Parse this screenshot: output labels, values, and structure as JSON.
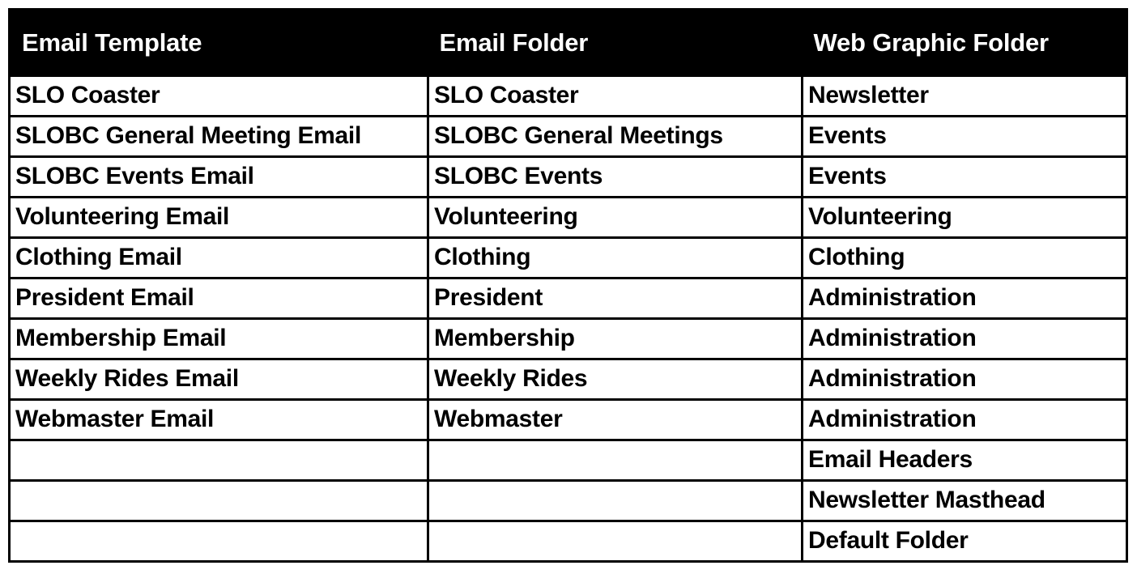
{
  "table": {
    "columns": [
      {
        "key": "email_template",
        "label": "Email Template"
      },
      {
        "key": "email_folder",
        "label": "Email Folder"
      },
      {
        "key": "web_graphic_folder",
        "label": "Web Graphic Folder"
      }
    ],
    "header_background": "#000000",
    "header_text_color": "#ffffff",
    "border_color": "#000000",
    "cell_background": "#ffffff",
    "cell_text_color": "#000000",
    "row_count": 12,
    "rows": [
      {
        "email_template": "SLO Coaster",
        "email_folder": "SLO Coaster",
        "web_graphic_folder": "Newsletter"
      },
      {
        "email_template": "SLOBC General Meeting Email",
        "email_folder": "SLOBC General Meetings",
        "web_graphic_folder": "Events"
      },
      {
        "email_template": "SLOBC Events Email",
        "email_folder": "SLOBC Events",
        "web_graphic_folder": "Events"
      },
      {
        "email_template": "Volunteering Email",
        "email_folder": "Volunteering",
        "web_graphic_folder": "Volunteering"
      },
      {
        "email_template": "Clothing Email",
        "email_folder": "Clothing",
        "web_graphic_folder": "Clothing"
      },
      {
        "email_template": "President Email",
        "email_folder": "President",
        "web_graphic_folder": "Administration"
      },
      {
        "email_template": "Membership Email",
        "email_folder": "Membership",
        "web_graphic_folder": "Administration"
      },
      {
        "email_template": "Weekly Rides Email",
        "email_folder": "Weekly Rides",
        "web_graphic_folder": "Administration"
      },
      {
        "email_template": "Webmaster Email",
        "email_folder": "Webmaster",
        "web_graphic_folder": "Administration"
      },
      {
        "email_template": "",
        "email_folder": "",
        "web_graphic_folder": "Email Headers"
      },
      {
        "email_template": "",
        "email_folder": "",
        "web_graphic_folder": "Newsletter Masthead"
      },
      {
        "email_template": "",
        "email_folder": "",
        "web_graphic_folder": "Default Folder"
      }
    ]
  }
}
